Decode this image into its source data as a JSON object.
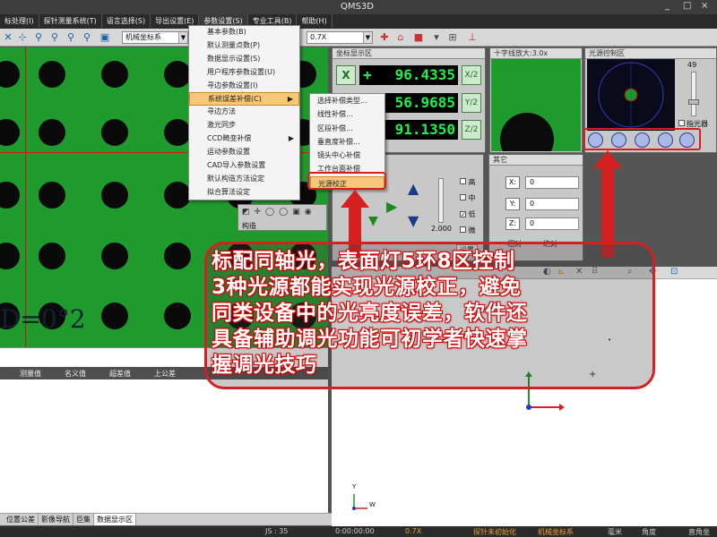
{
  "window": {
    "title": "QMS3D",
    "controls": [
      "_",
      "□",
      "×"
    ]
  },
  "menu": {
    "items": [
      "标处理(I)",
      "探针测量系统(T)",
      "语言选择(S)",
      "导出设置(E)",
      "参数设置(S)",
      "专业工具(B)",
      "帮助(H)"
    ],
    "active": 4
  },
  "toolbar": {
    "coord_system": "机械坐标系",
    "zoom": "0.7X"
  },
  "dropdown": {
    "items": [
      "基本参数(B)",
      "默认测量点数(P)",
      "数据显示设置(S)",
      "用户程序参数设置(U)",
      "寻边参数设置(I)",
      "系统误差补偿(C)",
      "寻边方法",
      "激光同步",
      "CCD畸变补偿",
      "运动参数设置",
      "CAD导入参数设置",
      "默认构造方法设定",
      "拟合算法设定"
    ],
    "highlighted": 5,
    "has_sub": [
      5,
      8
    ]
  },
  "submenu": {
    "items": [
      "选择补偿类型...",
      "线性补偿...",
      "区段补偿...",
      "垂直度补偿...",
      "镜头中心补偿",
      "工作台面补偿",
      "光源校正"
    ],
    "highlighted": 6
  },
  "coord_panel": {
    "title": "坐标显示区",
    "axes": [
      {
        "btn": "X",
        "value": "96.4335",
        "half": "X/2"
      },
      {
        "btn": "Y",
        "value": "56.9685",
        "half": "Y/2"
      },
      {
        "btn": "Z",
        "value": "91.1350",
        "half": "Z/2"
      }
    ],
    "plus": "+"
  },
  "cross_panel": {
    "title": "十字线放大:3.0x"
  },
  "light_panel": {
    "title": "光源控制区",
    "slider_value": "49",
    "pointer_label": "指光器",
    "button_count": 5
  },
  "mid_panel": {
    "checks": [
      "高",
      "中",
      "低",
      "微"
    ],
    "checked": 2,
    "slider_label": "2.000",
    "setting": "设置"
  },
  "other_panel": {
    "title": "其它",
    "fields": [
      {
        "label": "X:",
        "value": "0"
      },
      {
        "label": "Y:",
        "value": "0"
      },
      {
        "label": "Z:",
        "value": "0"
      }
    ],
    "modes": [
      "相对",
      "绝对"
    ]
  },
  "struct_panel": {
    "label": "构造"
  },
  "camera": {
    "overlay_text": "D=0°2"
  },
  "results": {
    "columns": [
      "测量值",
      "名义值",
      "超差值",
      "上公差"
    ]
  },
  "bottom_tabs": {
    "items": [
      "位置公差",
      "影像导航",
      "巨集",
      "数据显示区"
    ],
    "active": 3
  },
  "status": {
    "items": [
      "JS : 35",
      "0:00:00:00",
      "0.7X",
      "探针未初始化",
      "机械坐标系",
      "毫米",
      "角度",
      "直角坐"
    ]
  },
  "callout": {
    "lines": [
      "标配同轴光，表面灯5环8区控制",
      "3种光源都能实现光源校正，避免",
      "同类设备中的光亮度误差，软件还",
      "具备辅助调光功能可初学者快速掌",
      "握调光技巧"
    ]
  },
  "gizmo": {
    "labels": [
      "Y",
      "X",
      "W"
    ]
  },
  "colors": {
    "accent_red": "#d62020",
    "camera_green": "#1f9b2d",
    "readout_green": "#1ff04a",
    "menu_highlight": "#f7c77b"
  }
}
